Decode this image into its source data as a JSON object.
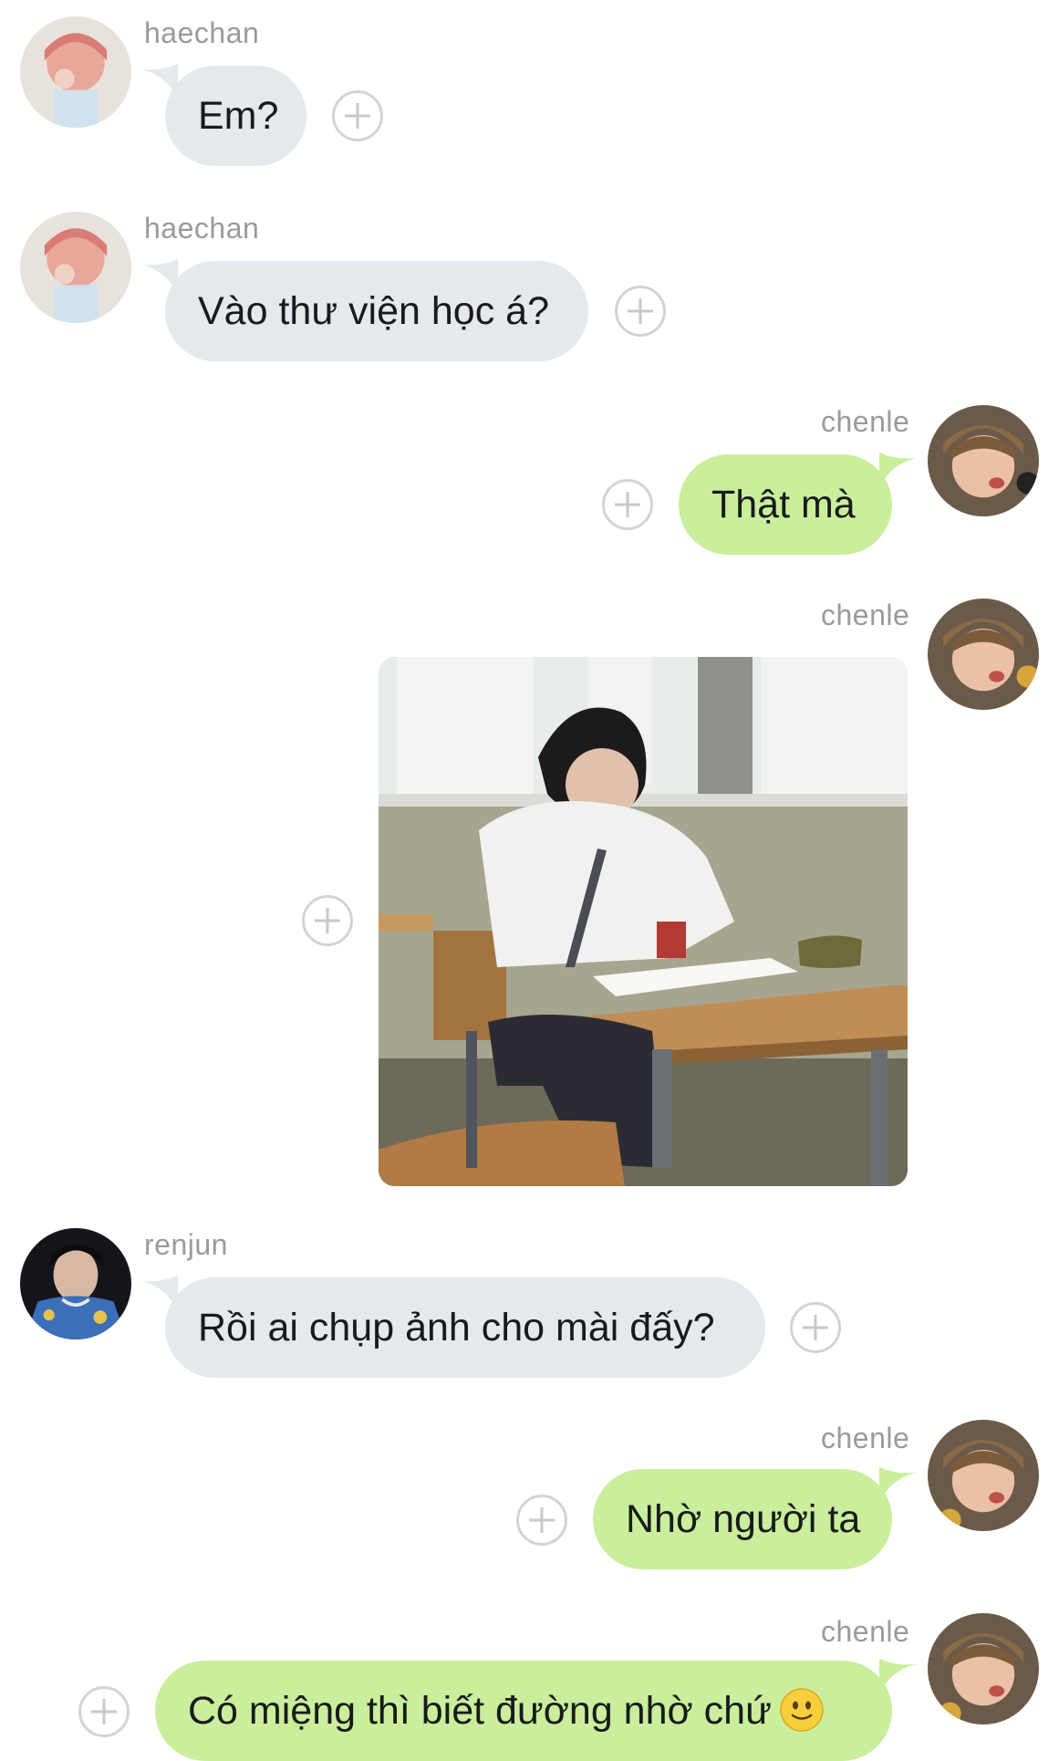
{
  "messages": [
    {
      "sender": "haechan",
      "text": "Em?"
    },
    {
      "sender": "haechan",
      "text": "Vào thư viện học á?"
    },
    {
      "sender": "chenle",
      "text": "Thật mà"
    },
    {
      "sender": "chenle",
      "text": ""
    },
    {
      "sender": "renjun",
      "text": "Rồi ai chụp ảnh cho mài đấy?"
    },
    {
      "sender": "chenle",
      "text": "Nhờ người ta"
    },
    {
      "sender": "chenle",
      "text": "Có miệng thì biết đường nhờ chứ"
    }
  ],
  "colors": {
    "incoming_bubble": "#e5e8ec",
    "outgoing_bubble": "#c9ee9c",
    "name_text": "#9a9a9a",
    "background": "#ffffff"
  },
  "icons": {
    "add": "plus-circle-icon",
    "emoji": "slightly-smiling-face-icon"
  }
}
